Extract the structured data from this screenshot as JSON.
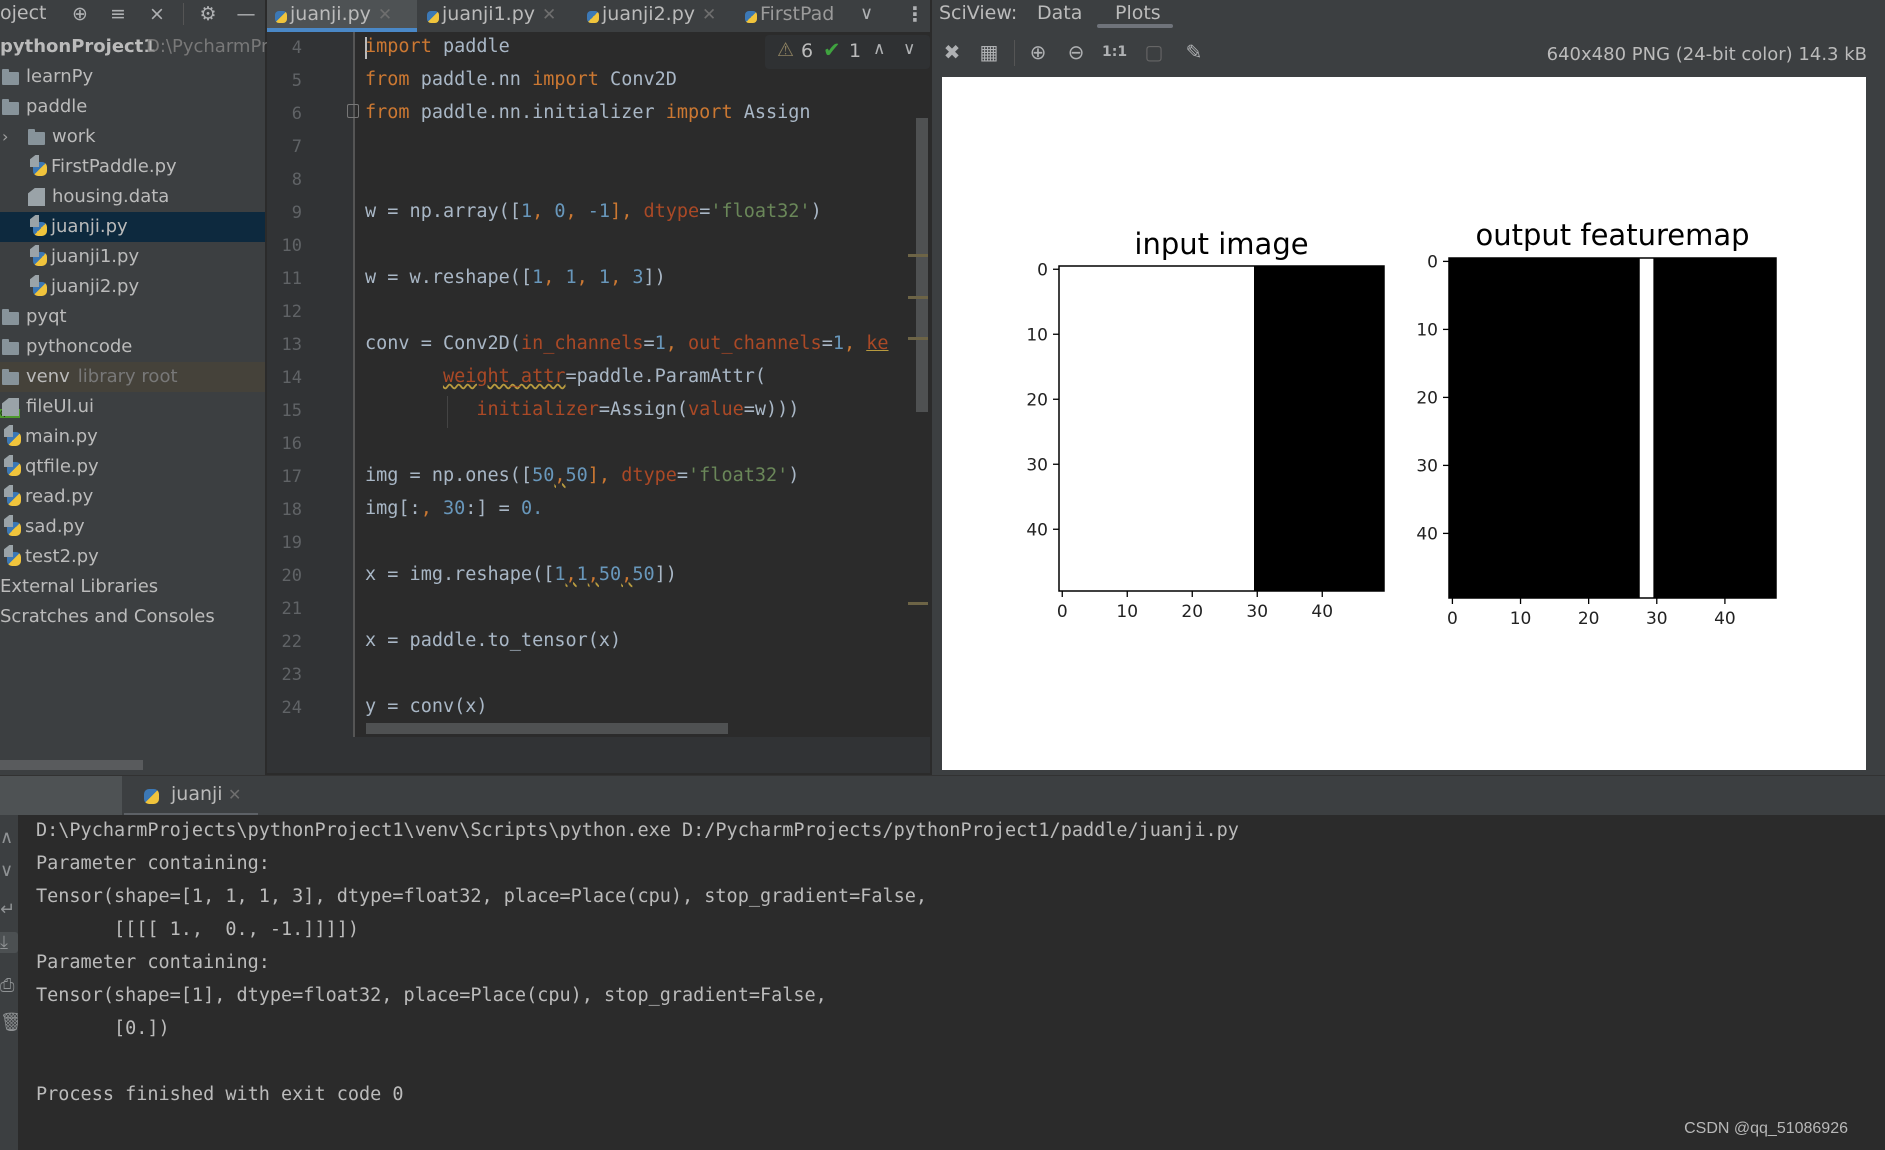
{
  "sidebar": {
    "title": "oject",
    "header_icons": [
      "locate-icon",
      "expand-all-icon",
      "collapse-all-icon",
      "gear-icon",
      "minimize-icon"
    ],
    "project_name": "pythonProject1",
    "project_path": "D:\\PycharmPro",
    "items": [
      {
        "label": "learnPy",
        "type": "folder",
        "indent": 0
      },
      {
        "label": "paddle",
        "type": "folder",
        "indent": 0
      },
      {
        "label": "work",
        "type": "folder",
        "indent": 1,
        "collapsed": true
      },
      {
        "label": "FirstPaddle.py",
        "type": "python",
        "indent": 1
      },
      {
        "label": "housing.data",
        "type": "data",
        "indent": 1
      },
      {
        "label": "juanji.py",
        "type": "python",
        "indent": 1,
        "selected": true
      },
      {
        "label": "juanji1.py",
        "type": "python",
        "indent": 1
      },
      {
        "label": "juanji2.py",
        "type": "python",
        "indent": 1
      },
      {
        "label": "pyqt",
        "type": "folder",
        "indent": 0
      },
      {
        "label": "pythoncode",
        "type": "folder",
        "indent": 0
      },
      {
        "label": "venv",
        "type": "folder",
        "indent": 0,
        "suffix": "library root"
      },
      {
        "label": "fileUI.ui",
        "type": "qt",
        "indent": 0
      },
      {
        "label": "main.py",
        "type": "python",
        "indent": 0
      },
      {
        "label": "qtfile.py",
        "type": "python",
        "indent": 0
      },
      {
        "label": "read.py",
        "type": "python",
        "indent": 0
      },
      {
        "label": "sad.py",
        "type": "python",
        "indent": 0
      },
      {
        "label": "test2.py",
        "type": "python",
        "indent": 0
      },
      {
        "label": "External Libraries",
        "type": "plain",
        "indent": 0
      },
      {
        "label": "Scratches and Consoles",
        "type": "plain",
        "indent": 0
      }
    ]
  },
  "editor": {
    "tabs": [
      {
        "label": "juanji.py",
        "active": true
      },
      {
        "label": "juanji1.py",
        "active": false
      },
      {
        "label": "juanji2.py",
        "active": false
      },
      {
        "label": "FirstPad",
        "active": false
      }
    ],
    "tab_overflow_icon": "chevron-down-icon",
    "tab_menu_icon": "kebab-menu-icon",
    "inspections": {
      "warnings": "6",
      "typos": "1"
    },
    "line_numbers": [
      "4",
      "5",
      "6",
      "7",
      "8",
      "9",
      "10",
      "11",
      "12",
      "13",
      "14",
      "15",
      "16",
      "17",
      "18",
      "19",
      "20",
      "21",
      "22",
      "23",
      "24"
    ],
    "code": {
      "l4_kw": "import",
      "l4_rest": " paddle",
      "l5_kw1": "from",
      "l5_mod": " paddle.nn ",
      "l5_kw2": "import",
      "l5_name": " Conv2D",
      "l6_kw1": "from",
      "l6_mod": " paddle.nn.initializer ",
      "l6_kw2": "import",
      "l6_name": " Assign",
      "l9_a": "w = np.array([",
      "l9_n1": "1",
      "l9_c1": ", ",
      "l9_n2": "0",
      "l9_c2": ", ",
      "l9_n3": "-1",
      "l9_c3": "], ",
      "l9_p": "dtype",
      "l9_eq": "=",
      "l9_s": "'float32'",
      "l9_end": ")",
      "l11_a": "w = w.reshape([",
      "l11_n1": "1",
      "l11_c1": ", ",
      "l11_n2": "1",
      "l11_c2": ", ",
      "l11_n3": "1",
      "l11_c3": ", ",
      "l11_n4": "3",
      "l11_end": "])",
      "l13_a": "conv = Conv2D(",
      "l13_p1": "in_channels",
      "l13_eq1": "=",
      "l13_n1": "1",
      "l13_c1": ", ",
      "l13_p2": "out_channels",
      "l13_eq2": "=",
      "l13_n2": "1",
      "l13_c2": ", ",
      "l13_p3": "ke",
      "l14_indent": "       ",
      "l14_p": "weight_attr",
      "l14_rest": "=paddle.ParamAttr(",
      "l15_indent": "          ",
      "l15_p1": "initializer",
      "l15_mid": "=Assign(",
      "l15_p2": "value",
      "l15_end": "=w)))",
      "l17_a": "img = np.ones([",
      "l17_n1": "50",
      "l17_c1": ",",
      "l17_n2": "50",
      "l17_c2": "], ",
      "l17_p": "dtype",
      "l17_eq": "=",
      "l17_s": "'float32'",
      "l17_end": ")",
      "l18_a": "img[:",
      "l18_c": ", ",
      "l18_n1": "30",
      "l18_b": ":] = ",
      "l18_n2": "0.",
      "l20_a": "x = img.reshape([",
      "l20_n1": "1",
      "l20_c1": ",",
      "l20_n2": "1",
      "l20_c2": ",",
      "l20_n3": "50",
      "l20_c3": ",",
      "l20_n4": "50",
      "l20_end": "])",
      "l22": "x = paddle.to_tensor(x)",
      "l24": "y = conv(x)"
    }
  },
  "sciview": {
    "label": "SciView:",
    "tabs": [
      {
        "label": "Data",
        "active": false
      },
      {
        "label": "Plots",
        "active": true
      }
    ],
    "toolbar_icons": [
      "fit-to-window-icon",
      "grid-icon",
      "zoom-in-icon",
      "zoom-out-icon",
      "actual-size-icon",
      "background-icon",
      "color-picker-icon"
    ],
    "actual_size_label": "1:1",
    "image_info": "640x480 PNG (24-bit color) 14.3 kB"
  },
  "chart_data": [
    {
      "type": "heatmap",
      "title": "input image",
      "colormap": "gray",
      "rows": 50,
      "cols": 50,
      "description": "ones(50,50) with columns 30..49 set to 0",
      "white_value": 1,
      "black_value": 0,
      "white_cols": [
        0,
        29
      ],
      "black_cols": [
        30,
        49
      ],
      "xlim": [
        -0.5,
        49.5
      ],
      "ylim": [
        49.5,
        -0.5
      ],
      "xticks": [
        "0",
        "10",
        "20",
        "30",
        "40"
      ],
      "yticks": [
        "0",
        "10",
        "20",
        "30",
        "40"
      ]
    },
    {
      "type": "heatmap",
      "title": "output featuremap",
      "colormap": "gray",
      "rows": 50,
      "cols": 48,
      "description": "conv with kernel [1,0,-1]; nonzero (white) at columns 28-29, zero elsewhere",
      "white_cols": [
        28,
        29
      ],
      "xlim": [
        -0.5,
        47.5
      ],
      "ylim": [
        49.5,
        -0.5
      ],
      "xticks": [
        "0",
        "10",
        "20",
        "30",
        "40"
      ],
      "yticks": [
        "0",
        "10",
        "20",
        "30",
        "40"
      ]
    }
  ],
  "run_panel": {
    "tab_label": "juanji",
    "toolbar_icons": [
      "up-icon",
      "down-icon",
      "soft-wrap-icon",
      "scroll-to-end-icon",
      "print-icon",
      "delete-icon"
    ],
    "output_lines": [
      "D:\\PycharmProjects\\pythonProject1\\venv\\Scripts\\python.exe D:/PycharmProjects/pythonProject1/paddle/juanji.py",
      "Parameter containing:",
      "Tensor(shape=[1, 1, 1, 3], dtype=float32, place=Place(cpu), stop_gradient=False,",
      "       [[[[ 1.,  0., -1.]]]])",
      "Parameter containing:",
      "Tensor(shape=[1], dtype=float32, place=Place(cpu), stop_gradient=False,",
      "       [0.])",
      "",
      "Process finished with exit code 0"
    ]
  },
  "watermark": "CSDN @qq_51086926"
}
